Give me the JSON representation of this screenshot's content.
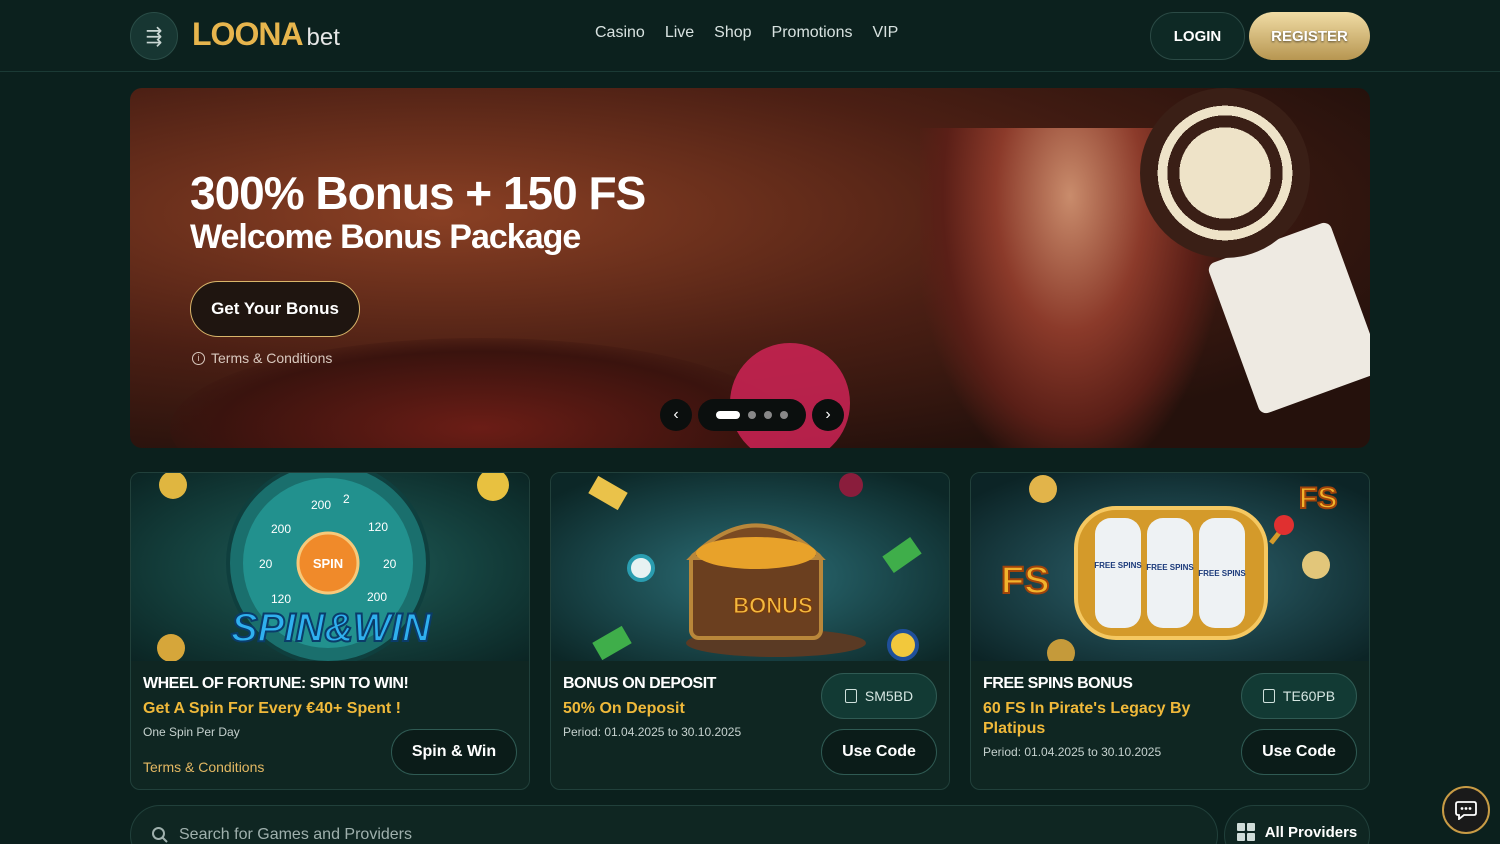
{
  "header": {
    "logo_main": "LOONA",
    "logo_sub": "bet",
    "nav": [
      "Casino",
      "Live",
      "Shop",
      "Promotions",
      "VIP"
    ],
    "login_label": "LOGIN",
    "register_label": "REGISTER"
  },
  "hero": {
    "title": "300% Bonus + 150 FS",
    "subtitle": "Welcome Bonus Package",
    "cta_label": "Get Your Bonus",
    "terms_label": "Terms & Conditions",
    "carousel": {
      "slides": 4,
      "active": 1
    }
  },
  "promos": [
    {
      "title": "WHEEL OF FORTUNE: SPIN TO WIN!",
      "subtitle": "Get A Spin For Every €40+ Spent !",
      "note": "One Spin Per Day",
      "terms_label": "Terms & Conditions",
      "action_label": "Spin & Win",
      "art_text": "SPIN&WIN",
      "wheel_center": "SPIN",
      "wheel_labels": [
        "200",
        "120",
        "20",
        "120",
        "200",
        "20",
        "200",
        "2"
      ]
    },
    {
      "title": "BONUS ON DEPOSIT",
      "subtitle": "50% On Deposit",
      "period": "Period: 01.04.2025 to 30.10.2025",
      "code": "SM5BD",
      "action_label": "Use Code",
      "art_text": "BONUS"
    },
    {
      "title": "FREE SPINS BONUS",
      "subtitle": "60 FS In Pirate's Legacy By Platipus",
      "period": "Period: 01.04.2025 to 30.10.2025",
      "code": "TE60PB",
      "action_label": "Use Code",
      "art_text": "FS",
      "reel_label": "FREE SPINS"
    }
  ],
  "search": {
    "placeholder": "Search for Games and Providers"
  },
  "providers_label": "All Providers",
  "colors": {
    "accent": "#e7b54d",
    "bg": "#0b201d",
    "promo_text": "#f0b93a"
  }
}
